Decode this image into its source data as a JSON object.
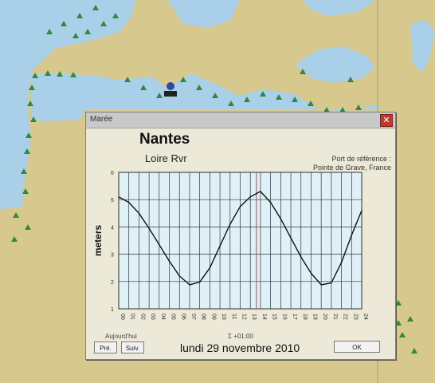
{
  "dialog": {
    "title": "Marée",
    "close_glyph": "✕",
    "place": "Nantes",
    "river": "Loire Rvr",
    "reference_line1": "Port de référence :",
    "reference_line2": "Pointe de Grave, France",
    "today_label": "Aujourd'hui",
    "timezone": "Σ +01:00",
    "date": "lundi 29 novembre 2010",
    "buttons": {
      "previous": "Pré.",
      "next": "Suiv.",
      "ok": "OK"
    }
  },
  "colors": {
    "sea": "#a9cfe9",
    "land": "#d7c98e",
    "coast_marker": "#2f8a3f",
    "plot_bg": "#dff0f6",
    "curve": "#111111",
    "now_line": "#d04040"
  },
  "chart_data": {
    "type": "line",
    "title": "",
    "xlabel": "",
    "ylabel": "meters",
    "x_ticks": [
      "00",
      "01",
      "02",
      "03",
      "04",
      "05",
      "06",
      "07",
      "08",
      "09",
      "10",
      "11",
      "12",
      "13",
      "14",
      "15",
      "16",
      "17",
      "18",
      "19",
      "20",
      "21",
      "22",
      "23",
      "24"
    ],
    "y_ticks": [
      "1",
      "2",
      "3",
      "4",
      "5",
      "6"
    ],
    "ylim": [
      1,
      6
    ],
    "xlim": [
      0,
      24
    ],
    "grid": true,
    "series": [
      {
        "x": [
          0,
          1,
          2,
          3,
          4,
          5,
          6,
          7,
          8,
          9,
          10,
          11,
          12,
          13,
          14,
          15,
          16,
          17,
          18,
          19,
          20,
          21,
          22,
          23,
          24
        ],
        "y": [
          5.1,
          4.9,
          4.5,
          3.95,
          3.35,
          2.75,
          2.2,
          1.88,
          1.98,
          2.5,
          3.3,
          4.1,
          4.75,
          5.1,
          5.3,
          4.9,
          4.3,
          3.6,
          2.9,
          2.3,
          1.88,
          1.95,
          2.7,
          3.7,
          4.6
        ]
      }
    ],
    "current_time_hour": 13.6
  }
}
